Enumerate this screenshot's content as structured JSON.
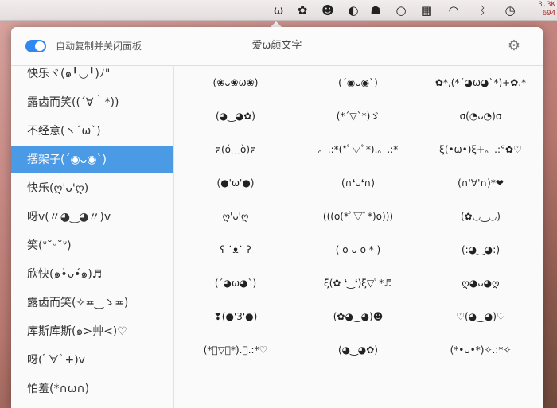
{
  "menubar": {
    "icons": [
      {
        "name": "omega-app-icon",
        "glyph": "ω"
      },
      {
        "name": "flower-gear-icon",
        "glyph": "✿"
      },
      {
        "name": "face-icon",
        "glyph": "☻"
      },
      {
        "name": "media-icon",
        "glyph": "◐"
      },
      {
        "name": "stack-icon",
        "glyph": "☗"
      },
      {
        "name": "ring-icon",
        "glyph": "○"
      },
      {
        "name": "battery-icon",
        "glyph": "▦"
      },
      {
        "name": "wifi-icon",
        "glyph": "◠"
      },
      {
        "name": "bluetooth-icon",
        "glyph": "ᛒ"
      },
      {
        "name": "time-machine-icon",
        "glyph": "◷"
      }
    ],
    "net_up": "3.3K",
    "net_down": "694"
  },
  "panel": {
    "toggle_label": "自动复制并关闭面板",
    "title": "爱ω颜文字"
  },
  "sidebar": {
    "items": [
      {
        "label": "快乐ヾ(๑╹◡╹)ﾉ\"",
        "selected": false
      },
      {
        "label": "露齿而笑((´∀｀*))",
        "selected": false
      },
      {
        "label": "不经意(ヽ´ω`)",
        "selected": false
      },
      {
        "label": "摆架子(´◉ᴗ◉`)",
        "selected": true
      },
      {
        "label": "快乐(ღ'ᴗ'ღ)",
        "selected": false
      },
      {
        "label": "呀v(〃◕‿◕〃)v",
        "selected": false
      },
      {
        "label": "笑(ᐡ˘ᵕ˘ᐡ)",
        "selected": false
      },
      {
        "label": "欣快(๑•̀ᴗ•́๑)♬",
        "selected": false
      },
      {
        "label": "露齿而笑(✧≖‿ゝ≖)",
        "selected": false
      },
      {
        "label": "库斯库斯(๑>艸<)♡",
        "selected": false
      },
      {
        "label": "呀(ﾟ∀ﾟ+)v",
        "selected": false
      },
      {
        "label": "怕羞(*∩ω∩)",
        "selected": false
      }
    ]
  },
  "grid": {
    "cells": [
      "(❀ᴗ❀ω❀)",
      "(´◉ᴗ◉`)",
      "✿*,(*´◕ω◕`*)+✿.*",
      "(◕‿◕✿)",
      "(*´▽`*)ゞ",
      "σ(◔ᴗ◔)σ",
      "ฅ(ó﹏ò)ฅ",
      "。.:*(*ﾟ▽ﾟ*).。.:*",
      "ξ(•ω•)ξ+。.:°✿♡",
      "(●'ω'●)",
      "(∩❛ᴗ❛∩)",
      "(∩'∀'∩)*❤",
      "ღ'ᴗ'ღ",
      "(((o(*ﾟ▽ﾟ*)o)))",
      "(✿◡‿◡)",
      "ʕ ˙ᴥ˙ ʔ",
      "( o ᴗ o * )",
      "(:◕‿◕:)",
      "(´◕ω◕`)",
      "ξ(✿ ❛‿❛)ξ▽ﾟ*♬",
      "ღ◕ᴗ◕ღ",
      "❣(●'3'●)",
      "(✿◕‿◕)☻",
      "♡(◕‿◕)♡",
      "(*ﾟ▽ﾟ*).。.:*♡",
      "(◕‿◕✿)",
      "(*•ᴗ•*)✧.:*✧"
    ]
  }
}
